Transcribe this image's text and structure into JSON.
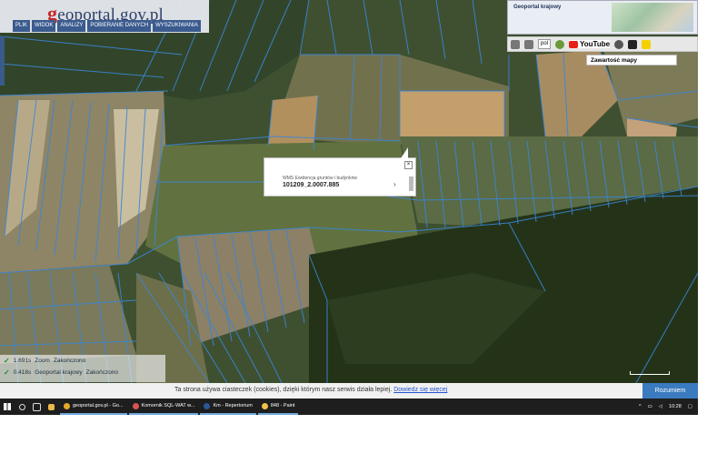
{
  "logo": {
    "g": "g",
    "text": "eoportal.gov.pl"
  },
  "menu": [
    "PLIK",
    "WIDOK",
    "ANALIZY",
    "POBIERANIE DANYCH",
    "WYSZUKIWANIA"
  ],
  "minimap": {
    "title": "Geoportal krajowy"
  },
  "toolbar": {
    "lang": "pol",
    "youtube": "YouTube"
  },
  "contents_button": "Zawartość mapy",
  "popup": {
    "layer": "WMS Ewidencja gruntów i budynków",
    "parcel_id": "101209_2.0007.885",
    "close": "×",
    "arrow": "›"
  },
  "status": [
    {
      "label": "1.691s",
      "name": "Zoom",
      "state": "Zakończono"
    },
    {
      "label": "0.418s",
      "name": "Geoportal krajowy",
      "state": "Zakończono"
    }
  ],
  "cookie": {
    "text": "Ta strona używa ciasteczek (cookies), dzięki którym nasz serwis działa lepiej.",
    "link": "Dowiedz się więcej",
    "accept": "Rozumiem"
  },
  "taskbar": {
    "tasks": [
      {
        "label": "geoportal.gov.pl - Go...",
        "color": "#e8a82b"
      },
      {
        "label": "Komornik SQL-WAT w...",
        "color": "#d9534f"
      },
      {
        "label": "Km - Repertorium",
        "color": "#2b5797"
      },
      {
        "label": "848 - Paint",
        "color": "#f0c14b"
      }
    ],
    "clock": "10:28"
  }
}
